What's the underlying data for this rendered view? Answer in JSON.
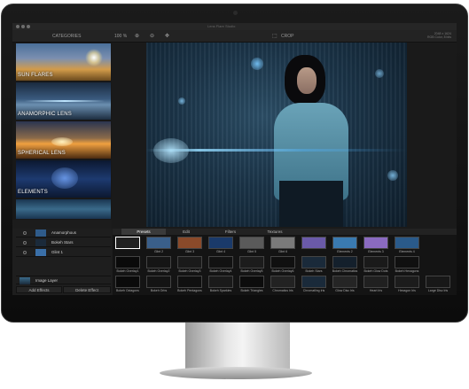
{
  "window": {
    "title": "Lens Flare Studio"
  },
  "toolbar": {
    "categories_label": "CATEGORIES",
    "zoom_level": "100 %",
    "crop_label": "CROP",
    "meta_line1": "2048 x 1624",
    "meta_line2": "RGB Color, 8 bits"
  },
  "sidebar": {
    "categories": [
      {
        "label": "SUN FLARES"
      },
      {
        "label": "ANAMORPHIC LENS"
      },
      {
        "label": "SPHERICAL LENS"
      },
      {
        "label": "ELEMENTS"
      }
    ]
  },
  "layers": {
    "rows": [
      {
        "label": "Anamorphous"
      },
      {
        "label": "Bokeh Stars"
      },
      {
        "label": "Glint 1"
      }
    ],
    "image_layer_label": "Image Layer",
    "add_effects_label": "Add Effects",
    "delete_effect_label": "Delete Effect"
  },
  "presets_panel": {
    "tabs": [
      "Presets",
      "Edit",
      "Filters",
      "Textures"
    ],
    "active_tab": "Presets",
    "rows": [
      [
        "",
        "Glint 2",
        "Glint 3",
        "Glint 4",
        "Glint 5",
        "Glint 6",
        "",
        "Elements 2",
        "Elements 3",
        "Elements 4"
      ],
      [
        "Bokeh Overlay1",
        "Bokeh Overlay2",
        "Bokeh Overlay3",
        "Bokeh Overlay4",
        "Bokeh Overlay5",
        "Bokeh Overlay6",
        "Bokeh Stars",
        "Bokeh Chromatics",
        "Bokeh Glow Dots",
        "Bokeh Hexagons"
      ],
      [
        "Bokeh Octagons",
        "Bokeh Orbs",
        "Bokeh Pentagons",
        "Bokeh Sparkles",
        "Bokeh Triangles",
        "Chromatics Iris",
        "Chromatling Iris",
        "Glow Disc Iris",
        "Heart Iris",
        "Hexagon Iris",
        "Large Disc Iris"
      ]
    ]
  },
  "colors": {
    "accent_selection": "#ffffff",
    "panel_bg": "#141414",
    "canvas_bg": "#1a1a1a"
  }
}
